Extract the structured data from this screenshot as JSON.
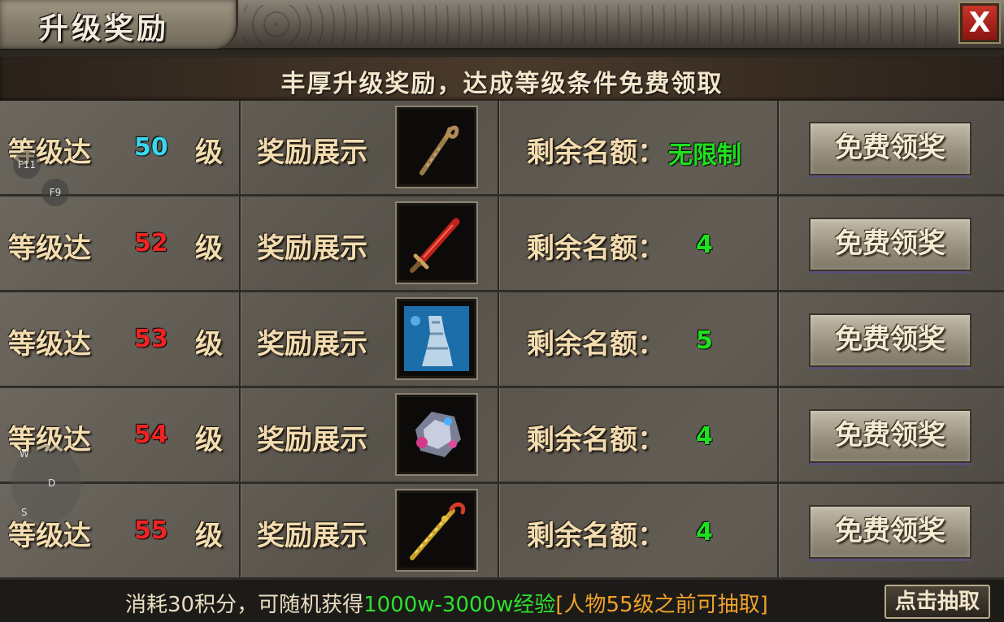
{
  "window": {
    "title": "升级奖励",
    "close_label": "X",
    "subtitle": "丰厚升级奖励，达成等级条件免费领取"
  },
  "labels": {
    "level_prefix": "等级达",
    "level_suffix": "级",
    "reward_display": "奖励展示",
    "remaining_quota": "剩余名额："
  },
  "rows": [
    {
      "level": "50",
      "level_color": "#3ad6ee",
      "item_icon": "wooden-staff-icon",
      "quota": "无限制",
      "button": "免费领奖"
    },
    {
      "level": "52",
      "level_color": "#ee2424",
      "item_icon": "red-sword-icon",
      "quota": "4",
      "button": "免费领奖"
    },
    {
      "level": "53",
      "level_color": "#ee2424",
      "item_icon": "blue-tower-icon",
      "quota": "5",
      "button": "免费领奖"
    },
    {
      "level": "54",
      "level_color": "#ee2424",
      "item_icon": "gem-ore-icon",
      "quota": "4",
      "button": "免费领奖"
    },
    {
      "level": "55",
      "level_color": "#ee2424",
      "item_icon": "golden-staff-icon",
      "quota": "4",
      "button": "免费领奖"
    }
  ],
  "footer": {
    "text_part1": "消耗30积分，可随机获得",
    "text_part2": "1000w-3000w经验",
    "text_part3": "[人物55级之前可抽取]",
    "draw_button": "点击抽取"
  },
  "overlay": {
    "hotkey_f11": "F11",
    "hotkey_f9": "F9",
    "joy_w": "W",
    "joy_d": "D",
    "joy_s": "S"
  }
}
